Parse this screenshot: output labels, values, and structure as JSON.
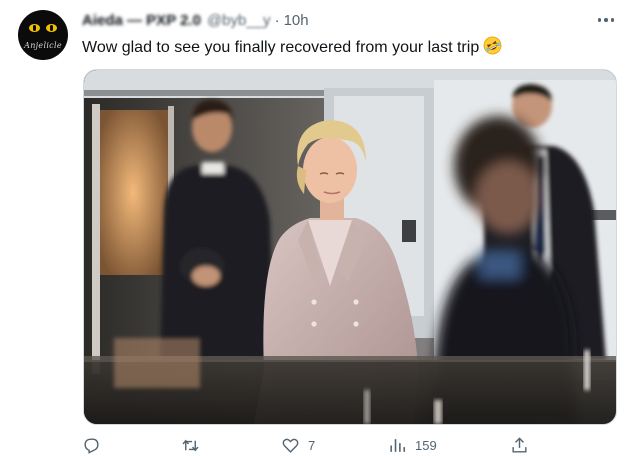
{
  "tweet": {
    "author_name": "Aieda — PXP 2.0",
    "author_handle": "@byb__y",
    "separator": "·",
    "time": "10h",
    "text": "Wow glad to see you finally recovered from your last trip",
    "emoji": "rolling-on-floor-laughing-emoji",
    "avatar_text": "Anjelicle"
  },
  "actions": {
    "reply_count": "",
    "retweet_count": "",
    "like_count": "7",
    "views_count": "159",
    "share_count": ""
  },
  "icons": {
    "more": "more-dots-icon",
    "reply": "reply-icon",
    "retweet": "retweet-icon",
    "like": "heart-icon",
    "views": "views-icon",
    "share": "share-icon"
  },
  "colors": {
    "text": "#0f1419",
    "secondary": "#536471",
    "border": "#cfd9de",
    "avatar_eye": "#f2c200"
  }
}
